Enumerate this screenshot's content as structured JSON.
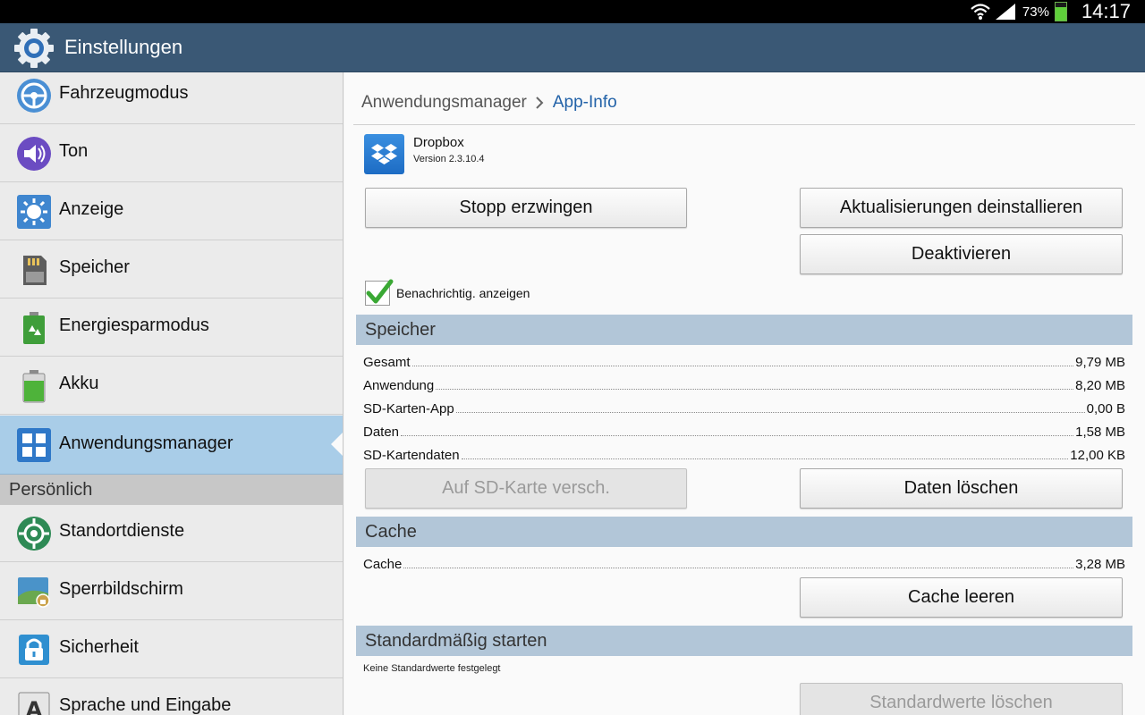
{
  "status_bar": {
    "battery_percent": "73%",
    "battery_level": 0.73,
    "time": "14:17"
  },
  "action_bar": {
    "title": "Einstellungen",
    "icon": "gear-icon"
  },
  "sidebar": {
    "items": [
      {
        "label": "Fahrzeugmodus",
        "icon": "steering-wheel-icon"
      },
      {
        "label": "Ton",
        "icon": "speaker-icon"
      },
      {
        "label": "Anzeige",
        "icon": "brightness-icon"
      },
      {
        "label": "Speicher",
        "icon": "sd-card-icon"
      },
      {
        "label": "Energiesparmodus",
        "icon": "recycle-battery-icon"
      },
      {
        "label": "Akku",
        "icon": "battery-icon"
      },
      {
        "label": "Anwendungsmanager",
        "icon": "apps-grid-icon",
        "active": true
      }
    ],
    "section_header": "Persönlich",
    "items2": [
      {
        "label": "Standortdienste",
        "icon": "location-icon"
      },
      {
        "label": "Sperrbildschirm",
        "icon": "lock-screen-icon"
      },
      {
        "label": "Sicherheit",
        "icon": "padlock-icon"
      },
      {
        "label": "Sprache und Eingabe",
        "icon": "language-icon"
      }
    ]
  },
  "breadcrumb": {
    "parent": "Anwendungsmanager",
    "current": "App-Info"
  },
  "app": {
    "name": "Dropbox",
    "version": "Version 2.3.10.4"
  },
  "buttons": {
    "force_stop": "Stopp erzwingen",
    "uninstall_updates": "Aktualisierungen deinstallieren",
    "deactivate": "Deaktivieren",
    "move_to_sd": "Auf SD-Karte versch.",
    "clear_data": "Daten löschen",
    "clear_cache": "Cache leeren",
    "clear_defaults": "Standardwerte löschen"
  },
  "notification_checkbox": {
    "label": "Benachrichtig. anzeigen",
    "checked": true
  },
  "storage": {
    "header": "Speicher",
    "rows": [
      {
        "key": "Gesamt",
        "value": "9,79 MB"
      },
      {
        "key": "Anwendung",
        "value": "8,20 MB"
      },
      {
        "key": "SD-Karten-App",
        "value": "0,00 B"
      },
      {
        "key": "Daten",
        "value": "1,58 MB"
      },
      {
        "key": "SD-Kartendaten",
        "value": "12,00 KB"
      }
    ]
  },
  "cache": {
    "header": "Cache",
    "rows": [
      {
        "key": "Cache",
        "value": "3,28 MB"
      }
    ]
  },
  "defaults": {
    "header": "Standardmäßig starten",
    "note": "Keine Standardwerte festgelegt"
  },
  "colors": {
    "action_bar": "#3a5875",
    "active_item": "#a9cde8",
    "section_header": "#b2c6d8",
    "link": "#2262a8"
  }
}
